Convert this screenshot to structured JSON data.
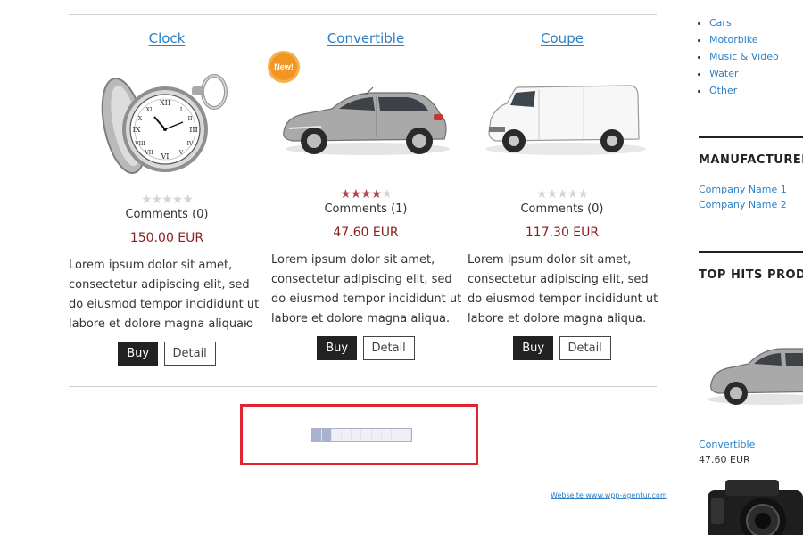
{
  "products": [
    {
      "title": "Clock",
      "image_icon": "pocket-watch",
      "rating": 0,
      "rating_max": 5,
      "comments": "Comments (0)",
      "price": "150.00 EUR",
      "description": "Lorem ipsum dolor sit amet, consectetur adipiscing elit, sed do eiusmod tempor incididunt ut labore et dolore magna aliquaю",
      "buy_label": "Buy",
      "detail_label": "Detail",
      "badge": ""
    },
    {
      "title": "Convertible",
      "image_icon": "silver-hatchback-car",
      "rating": 4,
      "rating_max": 5,
      "comments": "Comments (1)",
      "price": "47.60 EUR",
      "description": "Lorem ipsum dolor sit amet, consectetur adipiscing elit, sed do eiusmod tempor incididunt ut labore et dolore magna aliqua.",
      "buy_label": "Buy",
      "detail_label": "Detail",
      "badge": "New!"
    },
    {
      "title": "Coupe",
      "image_icon": "white-van",
      "rating": 0,
      "rating_max": 5,
      "comments": "Comments (0)",
      "price": "117.30 EUR",
      "description": "Lorem ipsum dolor sit amet, consectetur adipiscing elit, sed do eiusmod tempor incididunt ut labore et dolore magna aliqua.",
      "buy_label": "Buy",
      "detail_label": "Detail",
      "badge": ""
    }
  ],
  "pager": {
    "segments": 10,
    "active_segments": 2
  },
  "footer": {
    "link": "Webseite www.wpp-agentur.com"
  },
  "sidebar": {
    "categories": [
      "Cars",
      "Motorbike",
      "Music & Video",
      "Water",
      "Other"
    ],
    "manufacturers_heading": "MANUFACTURER",
    "manufacturers": [
      "Company Name 1",
      "Company Name 2"
    ],
    "top_hits_heading": "TOP HITS PRODU",
    "top_hit": {
      "title": "Convertible",
      "price": "47.60 EUR",
      "image_icon": "silver-hatchback-car"
    },
    "next_hit_icon": "camera"
  },
  "colors": {
    "link": "#2b80c7",
    "price": "#8b2020",
    "star_full": "#b1454a",
    "star_empty": "#d5d5d5",
    "highlight": "#e0252f",
    "button_dark": "#222222"
  }
}
